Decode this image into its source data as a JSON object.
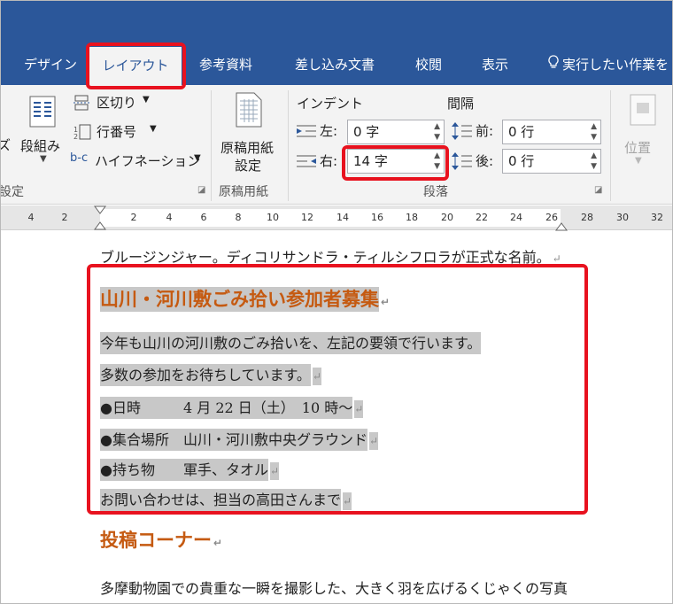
{
  "tabs": [
    {
      "label": "デザイン"
    },
    {
      "label": "レイアウト"
    },
    {
      "label": "参考資料"
    },
    {
      "label": "差し込み文書"
    },
    {
      "label": "校閲"
    },
    {
      "label": "表示"
    }
  ],
  "tellme": "実行したい作業を",
  "ribbon": {
    "page_setup": {
      "columns": "段組み",
      "breaks": "区切り",
      "line_numbers": "行番号",
      "hyphenation": "ハイフネーション",
      "group_label_fragment": "設定"
    },
    "genko": {
      "button_line1": "原稿用紙",
      "button_line2": "設定",
      "group_label": "原稿用紙"
    },
    "paragraph": {
      "indent_title": "インデント",
      "spacing_title": "間隔",
      "left_label": "左:",
      "left_value": "0 字",
      "right_label": "右:",
      "right_value": "14 字",
      "before_label": "前:",
      "before_value": "0 行",
      "after_label": "後:",
      "after_value": "0 行",
      "group_label": "段落"
    },
    "arrange": {
      "position": "位置"
    }
  },
  "ruler": {
    "ticks": [
      "4",
      "2",
      "2",
      "4",
      "6",
      "8",
      "10",
      "12",
      "14",
      "16",
      "18",
      "20",
      "22",
      "24",
      "26",
      "28",
      "30",
      "32"
    ]
  },
  "document": {
    "line0": "ブルージンジャー。ディコリサンドラ・ティルシフロラが正式な名前。",
    "heading1": "山川・河川敷ごみ拾い参加者募集",
    "body": [
      "今年も山川の河川敷のごみ拾いを、左記の要領で行います。",
      "多数の参加をお待ちしています。",
      "●日時　　　4 月 22 日（土）　10 時～",
      "●集合場所　山川・河川敷中央グラウンド",
      "●持ち物　　軍手、タオル",
      "お問い合わせは、担当の高田さんまで"
    ],
    "heading2": "投稿コーナー",
    "last_line": "多摩動物園での貴重な一瞬を撮影した、大きく羽を広げるくじゃくの写真"
  },
  "colors": {
    "ribbon_blue": "#2b579a",
    "heading_orange": "#c55a11",
    "highlight_red": "#e8121f",
    "selection_gray": "#c8c8c8"
  }
}
